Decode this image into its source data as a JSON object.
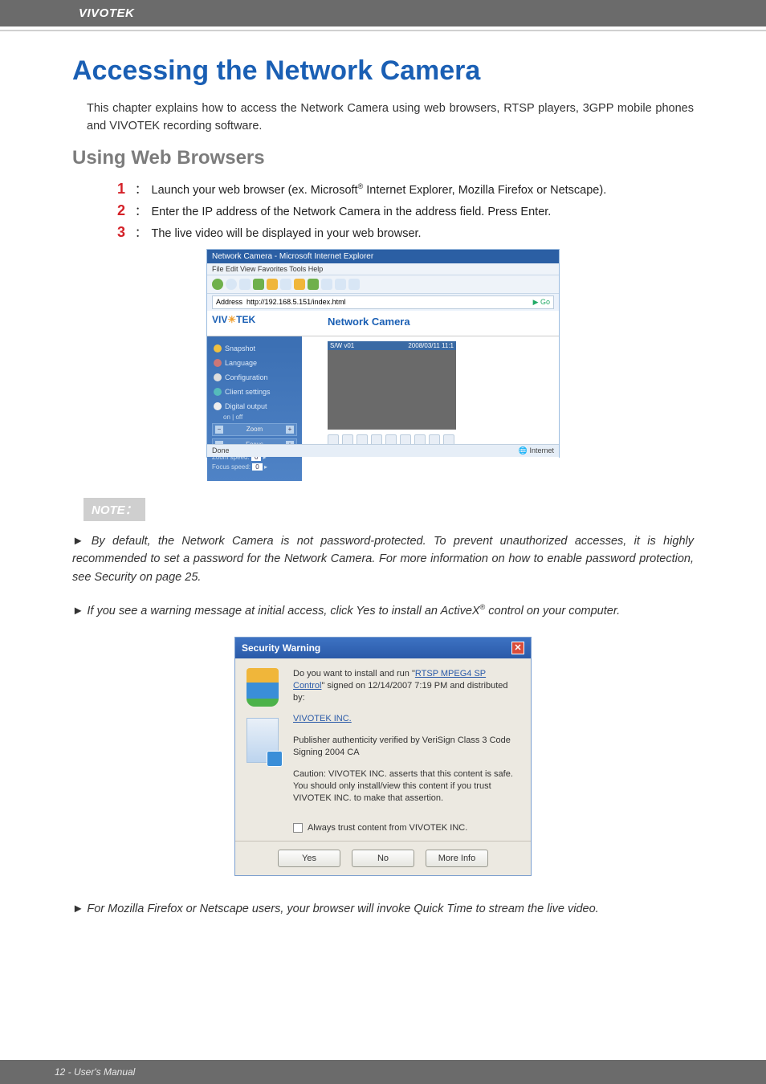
{
  "header": {
    "brand": "VIVOTEK"
  },
  "title": "Accessing the Network Camera",
  "intro": "This chapter explains how to access the Network Camera using web browsers, RTSP players, 3GPP mobile phones and VIVOTEK recording software.",
  "section_using": "Using Web Browsers",
  "steps": {
    "s1_pre": "Launch your web browser (ex. Microsoft",
    "s1_post": " Internet Explorer, Mozilla Firefox or Netscape).",
    "s2": "Enter the IP address of the Network Camera in the address field. Press Enter.",
    "s3": "The live video will be displayed in your web browser."
  },
  "ss1": {
    "window_title": "Network Camera - Microsoft Internet Explorer",
    "menu": "File   Edit   View   Favorites   Tools   Help",
    "addr_label": "Address",
    "addr_value": "http://192.168.5.151/index.html",
    "go": "Go",
    "brand_left": "VIV",
    "brand_right": "TEK",
    "cam_title": "Network Camera",
    "video_left": "S/W v01",
    "video_right": "2008/03/11 11:1",
    "side": {
      "snapshot": "Snapshot",
      "language": "Language",
      "configuration": "Configuration",
      "client_settings": "Client settings",
      "digital_output": "Digital output",
      "do_on": "on",
      "do_off": "off",
      "zoom": "Zoom",
      "focus": "Focus",
      "zoom_speed": "Zoom speed:",
      "zoom_val": "0",
      "focus_speed": "Focus speed:",
      "focus_val": "0"
    },
    "status_done": "Done",
    "status_net": "Internet"
  },
  "note_label": "NOTE：",
  "note1": "By default, the Network Camera is not password-protected. To prevent unauthorized accesses, it is highly recommended to set a password for the Network Camera. For more information on how to enable password protection, see Security on page 25.",
  "note2_pre": "If you see a warning message at initial access, click Yes to install an ActiveX",
  "note2_post": " control on your computer.",
  "dialog": {
    "title": "Security Warning",
    "line1_pre": "Do you want to install and run \"",
    "line1_link": "RTSP MPEG4 SP Control",
    "line1_post": "\" signed on 12/14/2007 7:19 PM and distributed by:",
    "vendor": "VIVOTEK INC.",
    "line2": "Publisher authenticity verified by VeriSign Class 3 Code Signing 2004 CA",
    "line3": "Caution: VIVOTEK INC. asserts that this content is safe. You should only install/view this content if you trust VIVOTEK INC. to make that assertion.",
    "always": "Always trust content from VIVOTEK INC.",
    "yes": "Yes",
    "no": "No",
    "more": "More Info"
  },
  "note3": "For Mozilla Firefox or Netscape users, your browser will invoke Quick Time to stream the live video.",
  "footer": "12 - User's Manual"
}
